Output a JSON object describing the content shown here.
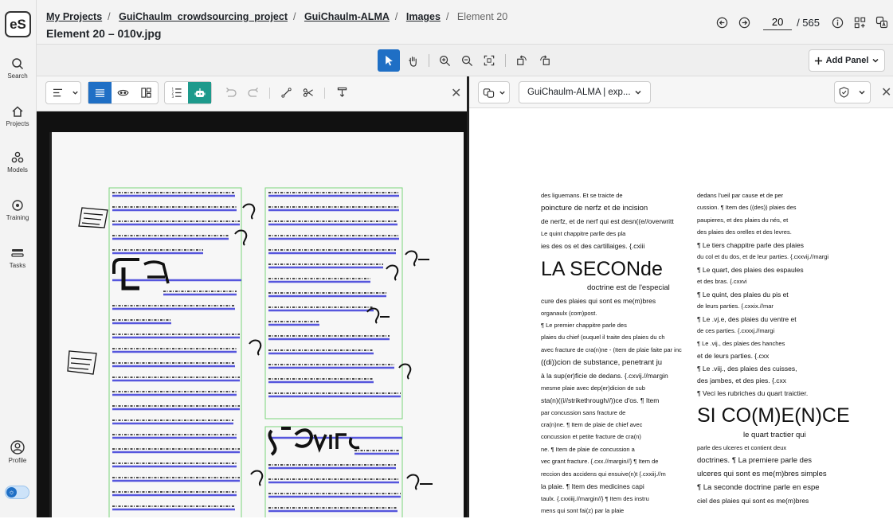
{
  "app": {
    "logo_text": "eS"
  },
  "nav": [
    {
      "label": "Search",
      "icon": "search-icon"
    },
    {
      "label": "Projects",
      "icon": "home-icon"
    },
    {
      "label": "Models",
      "icon": "models-icon"
    },
    {
      "label": "Training",
      "icon": "training-icon"
    },
    {
      "label": "Tasks",
      "icon": "tasks-icon"
    },
    {
      "label": "Profile",
      "icon": "profile-icon"
    }
  ],
  "breadcrumb": {
    "items": [
      "My Projects",
      "GuiChaulm_crowdsourcing_project",
      "GuiChaulm-ALMA",
      "Images"
    ],
    "current": "Element 20"
  },
  "page_title": "Element 20 – 010v.jpg",
  "pager": {
    "current": "20",
    "total": "/ 565"
  },
  "toolbar": {
    "add_panel": "Add Panel"
  },
  "right_panel": {
    "source_select": "GuiChaulm-ALMA | exp..."
  },
  "transcription": {
    "left": [
      {
        "t": "des liguemans. Et se traicte de",
        "c": "s"
      },
      {
        "t": "poincture de nerfz et de incision",
        "c": "l"
      },
      {
        "t": "de nerfz, et de nerf qui est desn((e//overwritt",
        "c": "m"
      },
      {
        "t": "Le quint chappitre parlle des pla",
        "c": "s"
      },
      {
        "t": "ies des os et des cartillaiges. {.cxiii",
        "c": "m"
      },
      {
        "t": "LA SECONde",
        "c": "t"
      },
      {
        "t": "doctrine est de l'especial",
        "c": "sub"
      },
      {
        "t": "cure des plaies qui sont es me(m)bres",
        "c": "m"
      },
      {
        "t": "organaulx (com)post.",
        "c": "s"
      },
      {
        "t": "¶ Le premier chappitre parle des",
        "c": "s"
      },
      {
        "t": "plaies du chief (ouquel il traite des plaies du ch",
        "c": "s"
      },
      {
        "t": "avec fracture de cra(n)ne - (Item de plaie faite par inc",
        "c": "s"
      },
      {
        "t": "((di))cion de substance, penetrant ju",
        "c": "l"
      },
      {
        "t": "à la sup(er)ficie de dedans. {.cxvij.//margin",
        "c": "m"
      },
      {
        "t": "mesme plaie avec dep(er)dicion de sub",
        "c": "s"
      },
      {
        "t": "sta(n)((i//strikethrough//))ce d'os. ¶ Item",
        "c": "m"
      },
      {
        "t": "par concussion sans fracture de",
        "c": "s"
      },
      {
        "t": "cra(n)ne. ¶ Item de plaie de chief avec",
        "c": "s"
      },
      {
        "t": "concussion et petite fracture de cra(n)",
        "c": "s"
      },
      {
        "t": "ne. ¶ Item de plaie de concussion a",
        "c": "s"
      },
      {
        "t": "vec grant fracture. {.cxx.//margin//} ¶ Item de",
        "c": "s"
      },
      {
        "t": "reccion des accidens qui ensuive(n)t {.cxxiij.//m",
        "c": "s"
      },
      {
        "t": "la plaie. ¶ Item des medicines capi",
        "c": "m"
      },
      {
        "t": "taulx. {.cxxiiij.//margin//} ¶ Item des instru",
        "c": "s"
      },
      {
        "t": "mens qui sont fai(z) par la plaie",
        "c": "s"
      }
    ],
    "right": [
      {
        "t": "dedans l'ueil par cause et de per",
        "c": "s"
      },
      {
        "t": "cussion. ¶ Item des ((des)) plaies des",
        "c": "s"
      },
      {
        "t": "paupieres, et des plaies du nés, et",
        "c": "s"
      },
      {
        "t": "des plaies des orelles et des levres.",
        "c": "s"
      },
      {
        "t": "¶ Le tiers chappitre parle des plaies",
        "c": "m"
      },
      {
        "t": "du col et du dos, et de leur parties. {.cxxvij.//margi",
        "c": "s"
      },
      {
        "t": "¶ Le quart, des plaies des espaules",
        "c": "m"
      },
      {
        "t": "et des bras. {.cxxvi",
        "c": "s"
      },
      {
        "t": "¶ Le quint, des plaies du pis et",
        "c": "m"
      },
      {
        "t": "de leurs parties. {.cxxix.//mar",
        "c": "s"
      },
      {
        "t": "¶ Le .vj.e, des plaies du ventre et",
        "c": "m"
      },
      {
        "t": "de ces parties. {.cxxxj.//margi",
        "c": "s"
      },
      {
        "t": "¶ Le .vij., des plaies des hanches",
        "c": "s"
      },
      {
        "t": "et de leurs parties. {.cxx",
        "c": "m"
      },
      {
        "t": "¶ Le .viij., des plaies des cuisses,",
        "c": "m"
      },
      {
        "t": "des jambes, et des pies. {.cxx",
        "c": "m"
      },
      {
        "t": "¶ Veci les rubriches du quart traictier.",
        "c": "m"
      },
      {
        "t": "SI CO(M)E(N)CE",
        "c": "t"
      },
      {
        "t": "le quart tractier qui",
        "c": "sub"
      },
      {
        "t": "parle des ulceres et contient deux",
        "c": "s"
      },
      {
        "t": "doctrines. ¶ La premiere parle des",
        "c": "l"
      },
      {
        "t": "ulceres qui sont es me(m)bres simples",
        "c": "l"
      },
      {
        "t": "¶ La seconde doctrine parle en espe",
        "c": "l"
      },
      {
        "t": "ciel des plaies qui sont es me(m)bres",
        "c": "m"
      }
    ]
  },
  "colors": {
    "accent": "#1f6fc5",
    "teal": "#1d9a8c"
  }
}
